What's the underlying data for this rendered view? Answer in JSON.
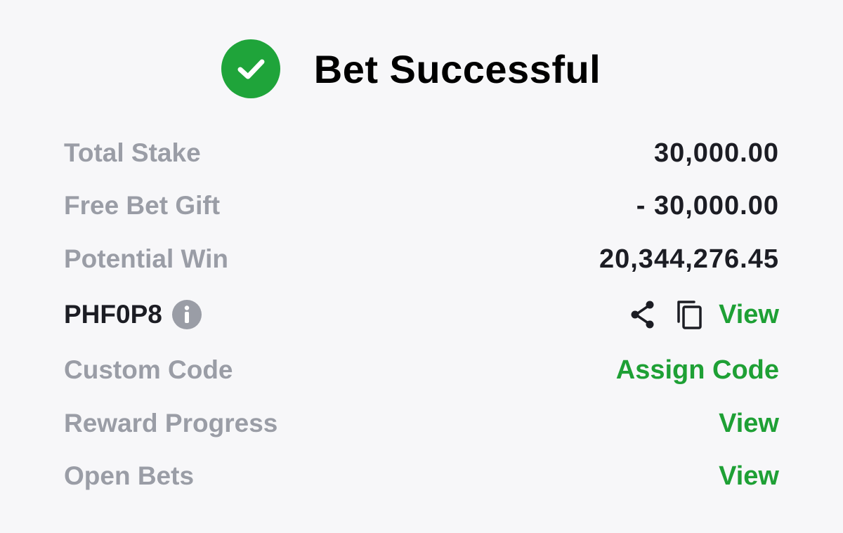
{
  "header": {
    "title": "Bet Successful",
    "status_icon": "check-circle-icon",
    "accent_color": "#1fa43a"
  },
  "rows": {
    "total_stake": {
      "label": "Total Stake",
      "value": "30,000.00"
    },
    "free_bet_gift": {
      "label": "Free Bet Gift",
      "value": "- 30,000.00"
    },
    "potential_win": {
      "label": "Potential Win",
      "value": "20,344,276.45"
    },
    "booking_code": {
      "code": "PHF0P8",
      "info_icon": "info-icon",
      "share_icon": "share-icon",
      "copy_icon": "copy-icon",
      "link": "View"
    },
    "custom_code": {
      "label": "Custom Code",
      "link": "Assign Code"
    },
    "reward_progress": {
      "label": "Reward Progress",
      "link": "View"
    },
    "open_bets": {
      "label": "Open Bets",
      "link": "View"
    }
  },
  "colors": {
    "background": "#f7f7f9",
    "label_gray": "#9a9da6",
    "value_dark": "#1c1d24",
    "link_green": "#1ea035"
  }
}
